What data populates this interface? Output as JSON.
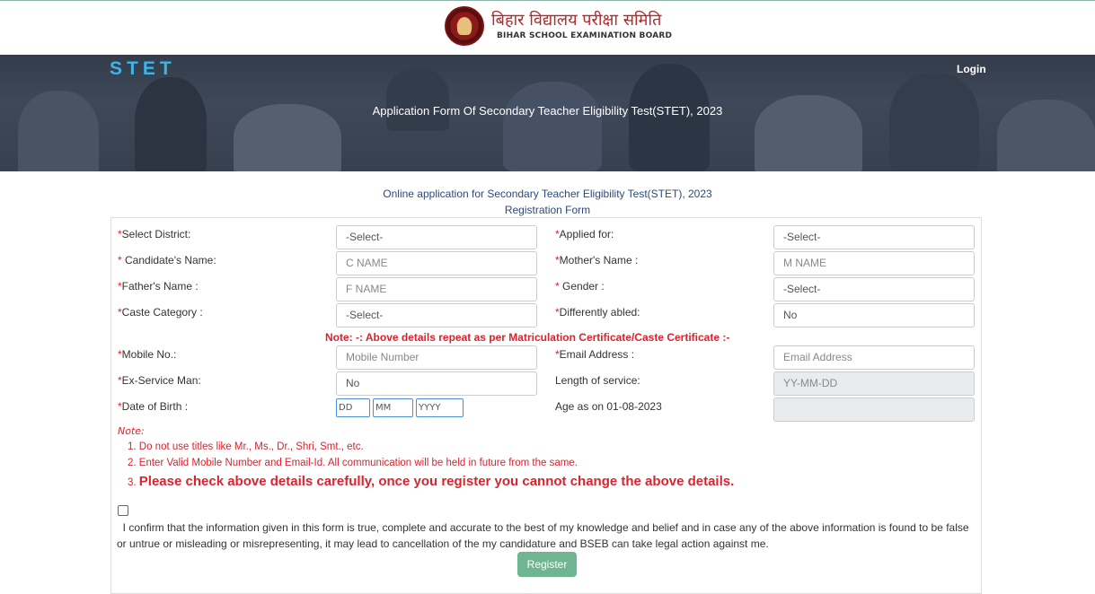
{
  "header": {
    "logo_hindi": "बिहार विद्यालय परीक्षा समिति",
    "logo_english": "BIHAR SCHOOL EXAMINATION BOARD"
  },
  "banner": {
    "brand": "STET",
    "login_label": "Login",
    "title": "Application Form Of Secondary Teacher Eligibility Test(STET), 2023"
  },
  "subheading": {
    "line1": "Online application for Secondary Teacher Eligibility Test(STET), 2023",
    "line2": "Registration Form"
  },
  "form": {
    "required_mark": "*",
    "select_district_label": "Select District:",
    "select_district_value": "-Select-",
    "applied_for_label": "Applied for:",
    "applied_for_value": "-Select-",
    "candidate_name_label": " Candidate's Name:",
    "candidate_name_placeholder": "C NAME",
    "mother_name_label": "Mother's Name :",
    "mother_name_placeholder": "M NAME",
    "father_name_label": "Father's Name :",
    "father_name_placeholder": "F NAME",
    "gender_label": " Gender :",
    "gender_value": "-Select-",
    "caste_label": "Caste Category :",
    "caste_value": "-Select-",
    "differently_abled_label": "Differently abled:",
    "differently_abled_value": "No",
    "matric_note": "Note: -: Above details repeat as per Matriculation Certificate/Caste Certificate :-",
    "mobile_label": "Mobile No.:",
    "mobile_placeholder": "Mobile Number",
    "email_label": "Email Address :",
    "email_placeholder": "Email Address",
    "ex_service_label": "Ex-Service Man:",
    "ex_service_value": "No",
    "length_service_label": "Length of service:",
    "length_service_placeholder": "YY-MM-DD",
    "dob_label": "Date of Birth :",
    "dob_dd": "DD",
    "dob_mm": "MM",
    "dob_yyyy": "YYYY",
    "age_label": "Age as on 01-08-2023",
    "age_value": ""
  },
  "notes": {
    "title": "Note:",
    "item1": "1. Do not use titles like Mr., Ms., Dr., Shri, Smt., etc.",
    "item2": "2. Enter Valid Mobile Number and Email-Id. All communication will be held in future from the same.",
    "item3_num": "3.",
    "item3_text": "Please check above details carefully, once you register you cannot change the above details."
  },
  "confirmation": {
    "text": "I confirm that the information given in this form is true, complete and accurate to the best of my knowledge and belief and in case any of the above information is found to be false or untrue or misleading or misrepresenting, it may lead to cancellation of the my candidature and BSEB can take legal action against me."
  },
  "register_label": "Register",
  "colors": {
    "brand_blue": "#3fb3e6",
    "required_red": "#d9232e",
    "register_green": "#6fb591"
  }
}
